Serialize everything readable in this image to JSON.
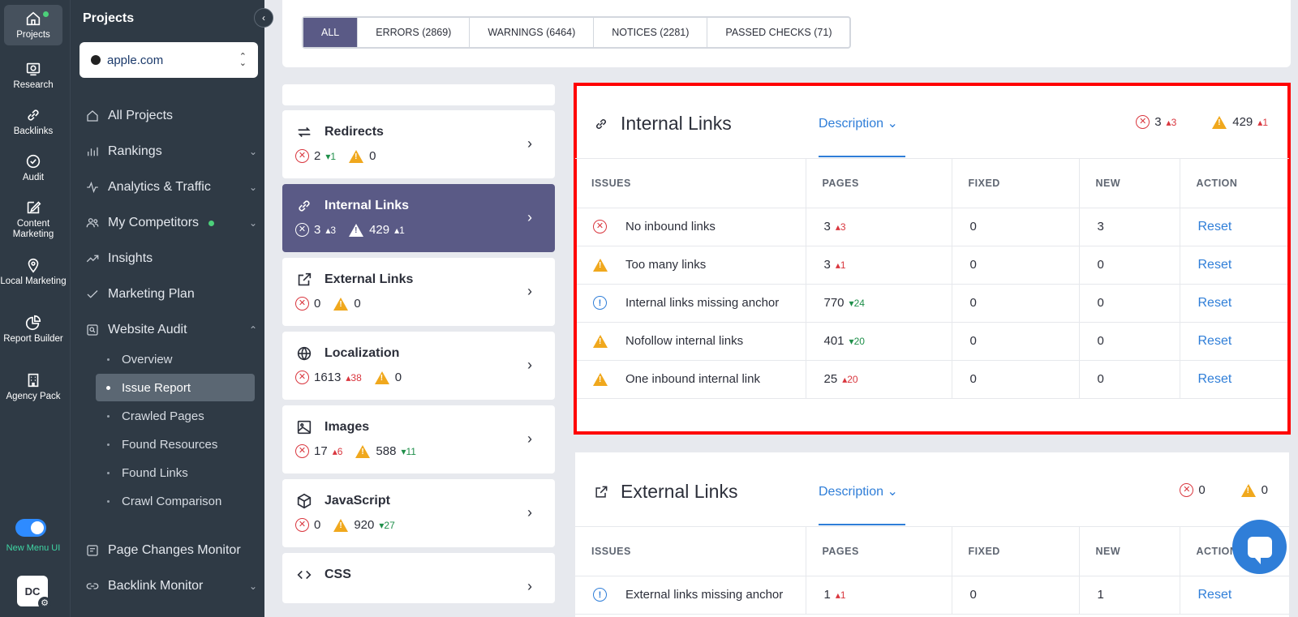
{
  "rail": {
    "items": [
      {
        "label": "Projects",
        "icon": "home-icon"
      },
      {
        "label": "Research",
        "icon": "research-icon"
      },
      {
        "label": "Backlinks",
        "icon": "link-icon"
      },
      {
        "label": "Audit",
        "icon": "check-circle-icon"
      },
      {
        "label": "Content Marketing",
        "icon": "edit-icon"
      },
      {
        "label": "Local Marketing",
        "icon": "map-pin-icon"
      },
      {
        "label": "Report Builder",
        "icon": "pie-chart-icon"
      },
      {
        "label": "Agency Pack",
        "icon": "building-icon"
      }
    ],
    "toggle_label": "New Menu UI",
    "avatar": "DC"
  },
  "sidebar": {
    "title": "Projects",
    "project": "apple.com",
    "items": [
      {
        "label": "All Projects"
      },
      {
        "label": "Rankings"
      },
      {
        "label": "Analytics & Traffic"
      },
      {
        "label": "My Competitors"
      },
      {
        "label": "Insights"
      },
      {
        "label": "Marketing Plan"
      },
      {
        "label": "Website Audit"
      },
      {
        "label": "Page Changes Monitor"
      },
      {
        "label": "Backlink Monitor"
      }
    ],
    "subitems": [
      {
        "label": "Overview"
      },
      {
        "label": "Issue Report"
      },
      {
        "label": "Crawled Pages"
      },
      {
        "label": "Found Resources"
      },
      {
        "label": "Found Links"
      },
      {
        "label": "Crawl Comparison"
      }
    ]
  },
  "filters": [
    "ALL",
    "ERRORS (2869)",
    "WARNINGS (6464)",
    "NOTICES (2281)",
    "PASSED CHECKS (71)"
  ],
  "categories": [
    {
      "name": "Redirects",
      "errors": "2",
      "err_delta": "1",
      "warnings": "0"
    },
    {
      "name": "Internal Links",
      "errors": "3",
      "err_delta": "3",
      "warnings": "429",
      "warn_delta": "1"
    },
    {
      "name": "External Links",
      "errors": "0",
      "warnings": "0"
    },
    {
      "name": "Localization",
      "errors": "1613",
      "err_delta": "38",
      "warnings": "0"
    },
    {
      "name": "Images",
      "errors": "17",
      "err_delta": "6",
      "warnings": "588",
      "warn_delta": "11"
    },
    {
      "name": "JavaScript",
      "errors": "0",
      "warnings": "920",
      "warn_delta": "27"
    },
    {
      "name": "CSS"
    }
  ],
  "panel_internal": {
    "title": "Internal Links",
    "description": "Description",
    "errors": "3",
    "err_delta": "3",
    "warnings": "429",
    "warn_delta": "1",
    "headers": [
      "ISSUES",
      "PAGES",
      "FIXED",
      "NEW",
      "ACTION"
    ],
    "rows": [
      {
        "issue": "No inbound links",
        "pages": "3",
        "delta": "3",
        "fixed": "0",
        "new": "3",
        "action": "Reset"
      },
      {
        "issue": "Too many links",
        "pages": "3",
        "delta": "1",
        "fixed": "0",
        "new": "0",
        "action": "Reset"
      },
      {
        "issue": "Internal links missing anchor",
        "pages": "770",
        "delta": "24",
        "fixed": "0",
        "new": "0",
        "action": "Reset"
      },
      {
        "issue": "Nofollow internal links",
        "pages": "401",
        "delta": "20",
        "fixed": "0",
        "new": "0",
        "action": "Reset"
      },
      {
        "issue": "One inbound internal link",
        "pages": "25",
        "delta": "20",
        "fixed": "0",
        "new": "0",
        "action": "Reset"
      }
    ]
  },
  "panel_external": {
    "title": "External Links",
    "description": "Description",
    "errors": "0",
    "warnings": "0",
    "headers": [
      "ISSUES",
      "PAGES",
      "FIXED",
      "NEW",
      "ACTION"
    ],
    "rows": [
      {
        "issue": "External links missing anchor",
        "pages": "1",
        "delta": "1",
        "fixed": "0",
        "new": "1",
        "action": "Reset"
      }
    ]
  },
  "colors": {
    "accent": "#5a5a86",
    "link": "#2f7ed8",
    "error": "#d9363e",
    "warning": "#f0a81d",
    "highlight": "#ff0000"
  }
}
